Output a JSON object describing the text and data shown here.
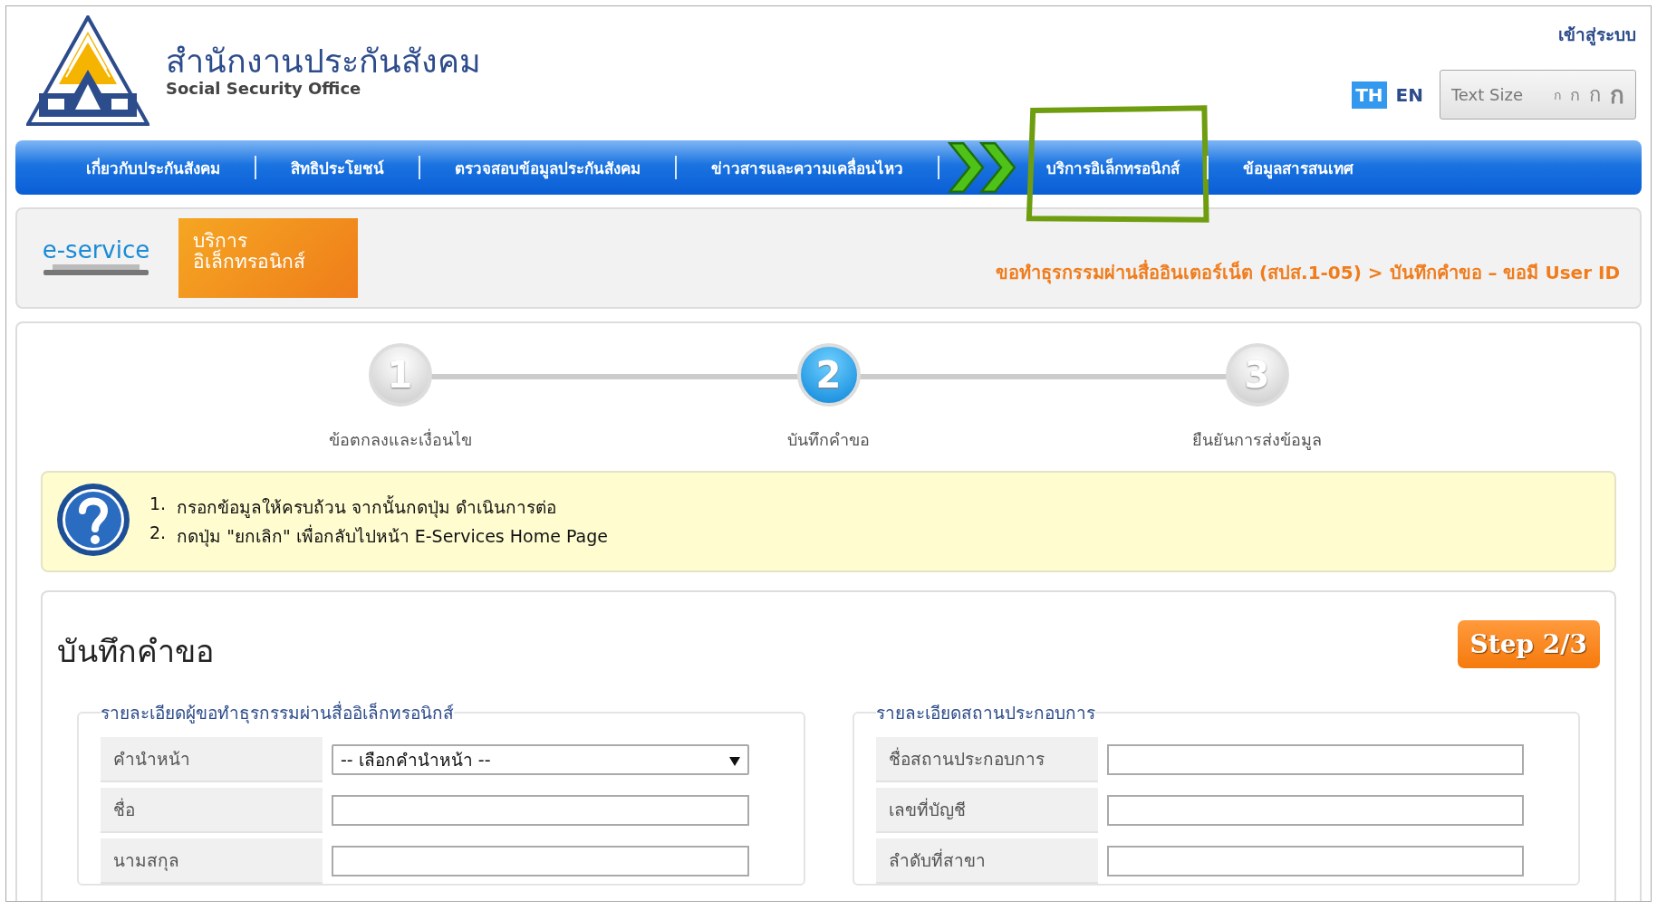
{
  "header": {
    "org_name_th": "สำนักงานประกันสังคม",
    "org_name_en": "Social Security Office",
    "login_link": "เข้าสู่ระบบ",
    "languages": [
      {
        "label": "TH",
        "selected": true
      },
      {
        "label": "EN",
        "selected": false
      }
    ],
    "text_size": {
      "label": "Text Size",
      "options": [
        "ก",
        "ก",
        "ก",
        "ก"
      ]
    }
  },
  "nav": {
    "items": [
      {
        "label": "เกี่ยวกับประกันสังคม",
        "annotated": false
      },
      {
        "label": "สิทธิประโยชน์",
        "annotated": false
      },
      {
        "label": "ตรวจสอบข้อมูลประกันสังคม",
        "annotated": false
      },
      {
        "label": "ข่าวสารและความเคลื่อนไหว",
        "annotated": false
      },
      {
        "label": "บริการอิเล็กทรอนิกส์",
        "annotated": true
      },
      {
        "label": "ข้อมูลสารสนเทศ",
        "annotated": false
      }
    ]
  },
  "banner": {
    "eservice_label": "e-service",
    "service_title_lines": [
      "บริการ",
      "อิเล็กทรอนิกส์"
    ],
    "breadcrumb": "ขอทำธุรกรรมผ่านสื่ออินเตอร์เน็ต (สปส.1-05) > บันทึกคำขอ – ขอมี User ID"
  },
  "steps": [
    {
      "number": "1",
      "label": "ข้อตกลงและเงื่อนไข",
      "selected": false
    },
    {
      "number": "2",
      "label": "บันทึกคำขอ",
      "selected": true
    },
    {
      "number": "3",
      "label": "ยืนยันการส่งข้อมูล",
      "selected": false
    }
  ],
  "help": {
    "items": [
      {
        "number": "1.",
        "text": "กรอกข้อมูลให้ครบถ้วน จากนั้นกดปุ่ม ดำเนินการต่อ"
      },
      {
        "number": "2.",
        "text": "กดปุ่ม \"ยกเลิก\" เพื่อกลับไปหน้า E-Services Home Page"
      }
    ]
  },
  "form": {
    "title": "บันทึกคำขอ",
    "step_badge": "Step 2/3",
    "sections": [
      {
        "legend": "รายละเอียดผู้ขอทำธุรกรรมผ่านสื่ออิเล็กทรอนิกส์",
        "fields": [
          {
            "label": "คำนำหน้า",
            "kind": "select",
            "value": "-- เลือกคำนำหน้า --"
          },
          {
            "label": "ชื่อ",
            "kind": "text"
          },
          {
            "label": "นามสกุล",
            "kind": "text"
          }
        ]
      },
      {
        "legend": "รายละเอียดสถานประกอบการ",
        "fields": [
          {
            "label": "ชื่อสถานประกอบการ",
            "kind": "text"
          },
          {
            "label": "เลขที่บัญชี",
            "kind": "text"
          },
          {
            "label": "ลำดับที่สาขา",
            "kind": "text"
          }
        ]
      }
    ]
  }
}
